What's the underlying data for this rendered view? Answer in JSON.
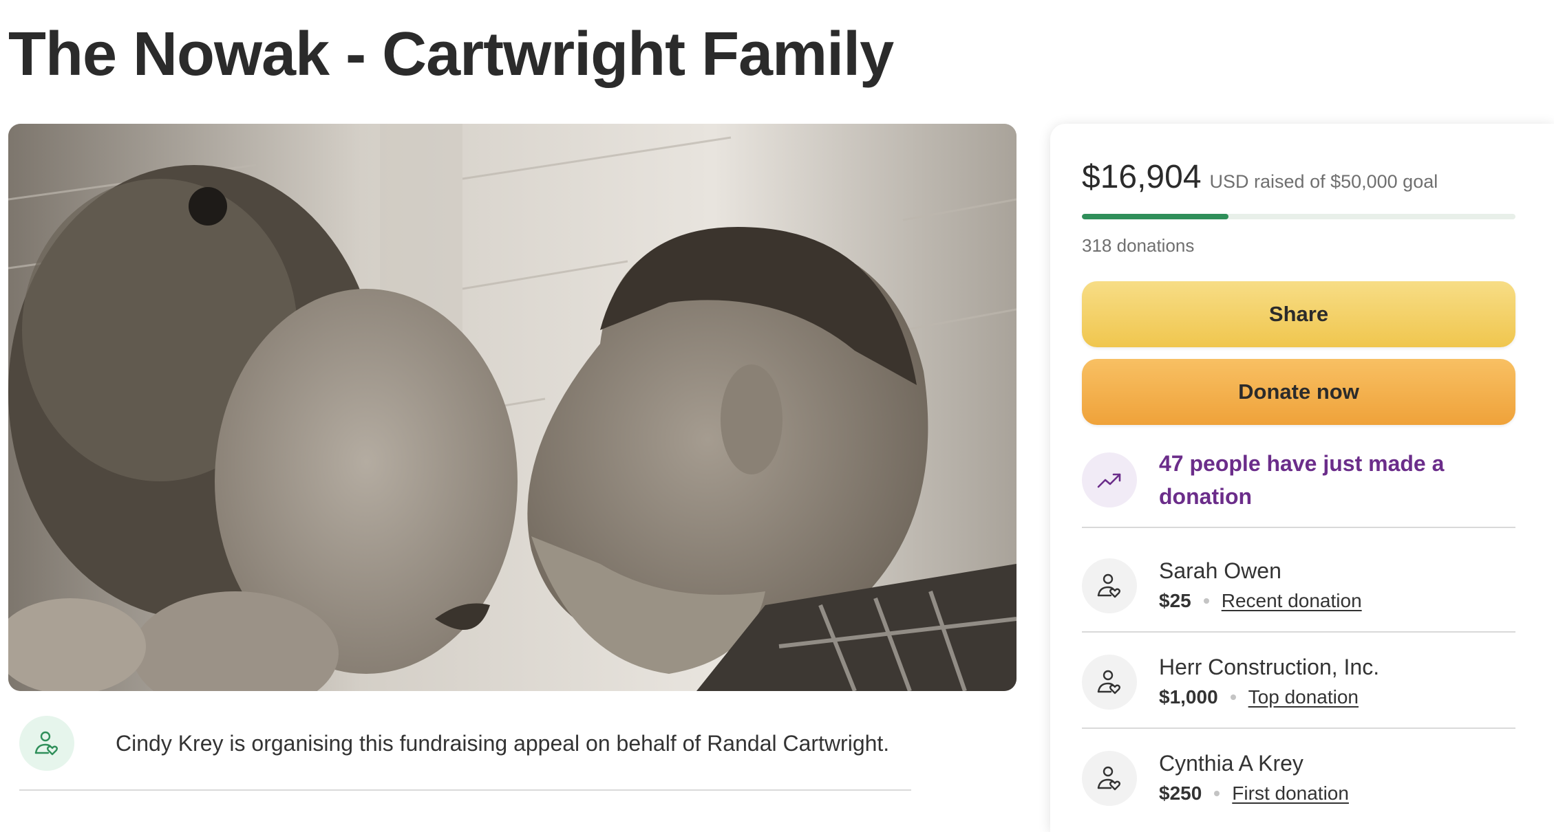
{
  "page": {
    "title": "The Nowak - Cartwright Family"
  },
  "hero": {
    "alt": "Black-and-white photo of a smiling couple facing each other"
  },
  "organiser": {
    "icon": "person-heart-icon",
    "text": "Cindy Krey is organising this fundraising appeal on behalf of Randal Cartwright."
  },
  "progress": {
    "raised_amount": "$16,904",
    "raised_suffix": "USD raised of $50,000 goal",
    "raised_value": 16904,
    "goal_value": 50000,
    "fraction": 0.338,
    "donations_count": "318 donations",
    "bar_fill_color": "#2f8f5a"
  },
  "actions": {
    "share_label": "Share",
    "donate_label": "Donate now"
  },
  "trend": {
    "icon": "trending-up-icon",
    "text": "47 people have just made a donation",
    "color": "#6b2d8a"
  },
  "donors": [
    {
      "name": "Sarah Owen",
      "amount": "$25",
      "tag": "Recent donation"
    },
    {
      "name": "Herr Construction, Inc.",
      "amount": "$1,000",
      "tag": "Top donation"
    },
    {
      "name": "Cynthia A Krey",
      "amount": "$250",
      "tag": "First donation"
    }
  ]
}
